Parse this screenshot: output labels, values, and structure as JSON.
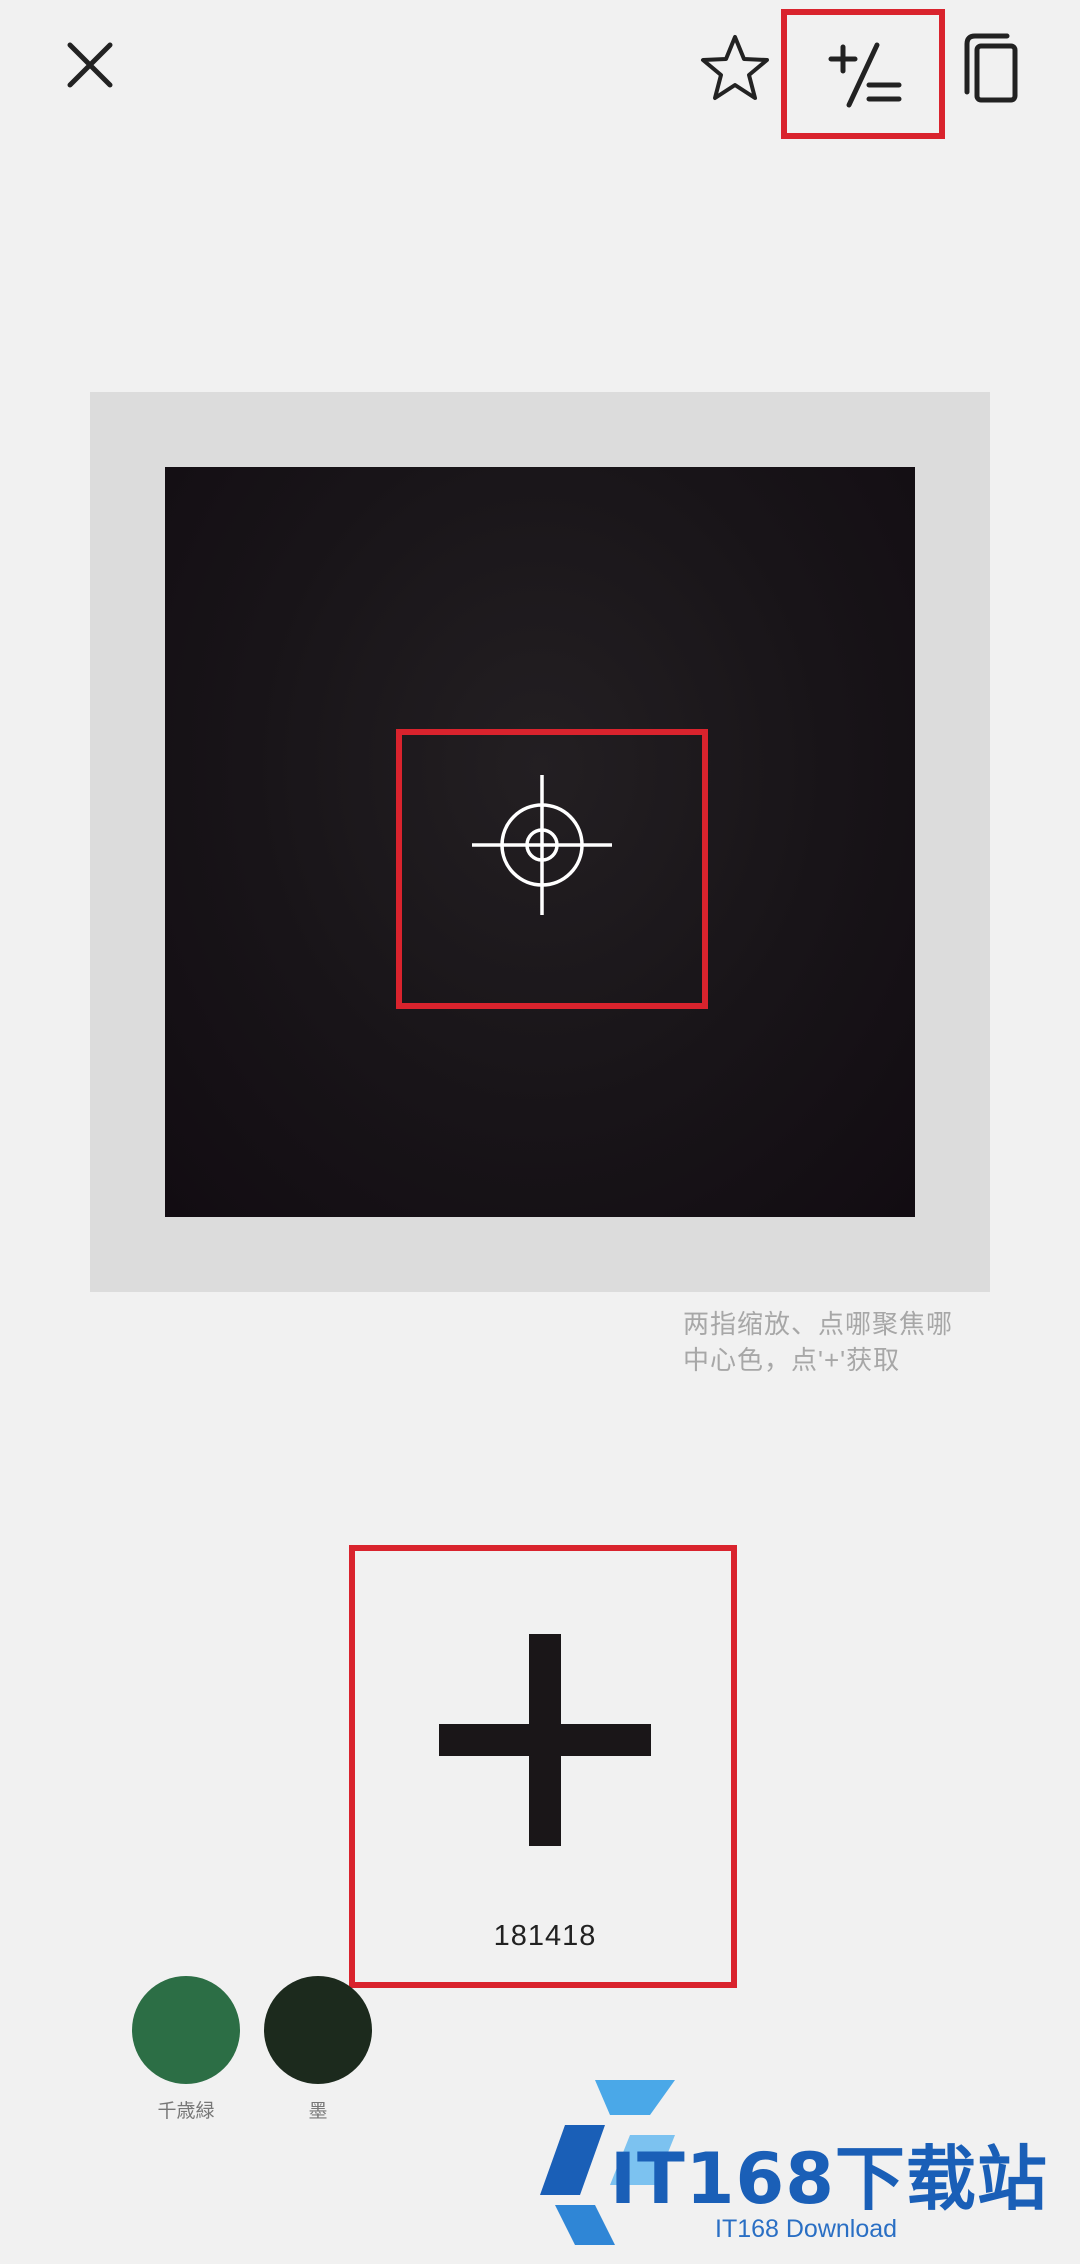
{
  "toolbar": {
    "close_icon": "close-icon",
    "favorite_icon": "star-outline-icon",
    "add_to_list_icon": "plus-list-icon",
    "copy_icon": "copy-icon"
  },
  "preview": {
    "crosshair_icon": "crosshair-icon",
    "hint": "两指缩放、点哪聚焦哪\n中心色，点'+'获取"
  },
  "picker": {
    "add_icon": "plus-icon",
    "hex_value": "181418"
  },
  "saved_colors": [
    {
      "name": "千歳緑",
      "color": "#2c6e45"
    },
    {
      "name": "墨",
      "color": "#1c2a1d"
    }
  ],
  "watermark": {
    "title": "IT168下载站",
    "subtitle": "IT168 Download"
  },
  "colors": {
    "highlight_red": "#d9232d",
    "background": "#f1f1f1",
    "preview_frame": "#dcdcdc",
    "preview_color": "#181418",
    "icon": "#222222"
  }
}
